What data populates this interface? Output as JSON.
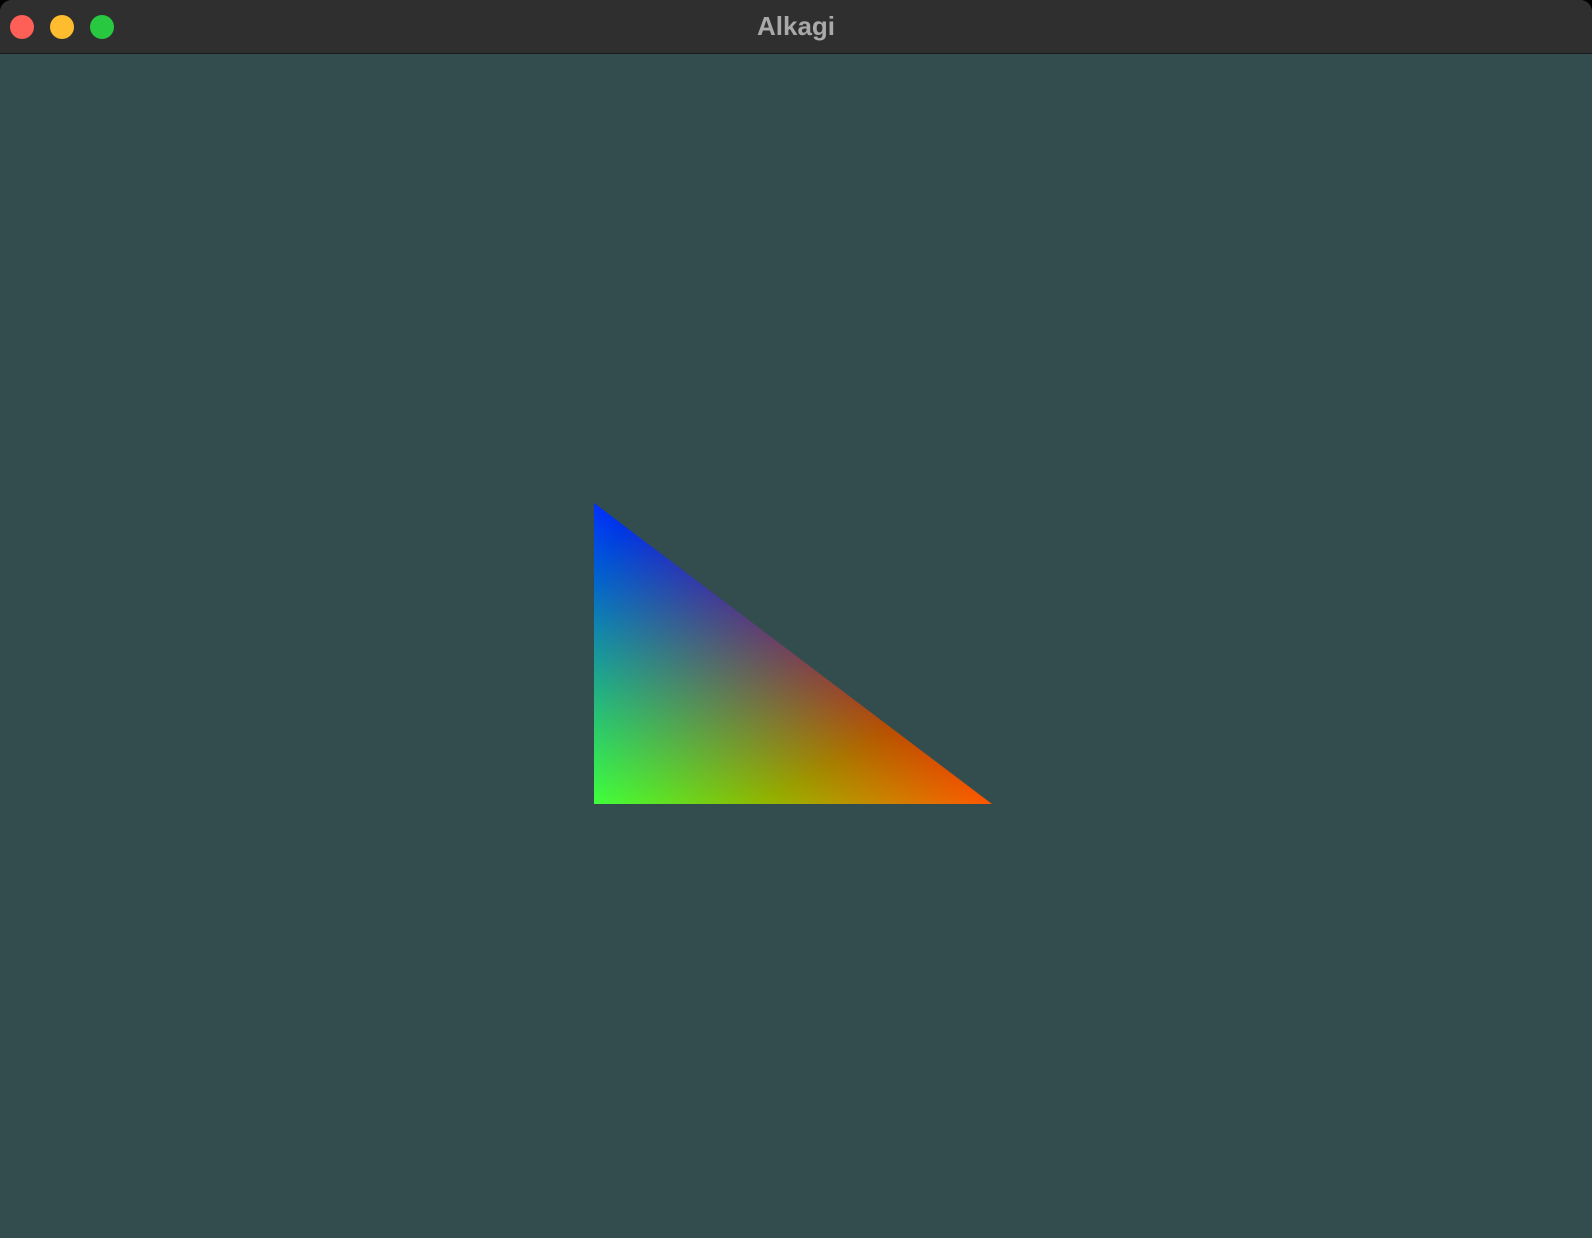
{
  "window": {
    "title": "Alkagi",
    "background_color": "#334d4f",
    "titlebar_color": "#2f2f2f"
  },
  "traffic_lights": {
    "close_color": "#fe5f57",
    "minimize_color": "#febc2e",
    "zoom_color": "#28c840"
  },
  "scene": {
    "shape": "triangle",
    "vertex_colors": {
      "top_left": "#0000ff",
      "bottom_left": "#00ff00",
      "bottom_right": "#ff0000"
    }
  }
}
